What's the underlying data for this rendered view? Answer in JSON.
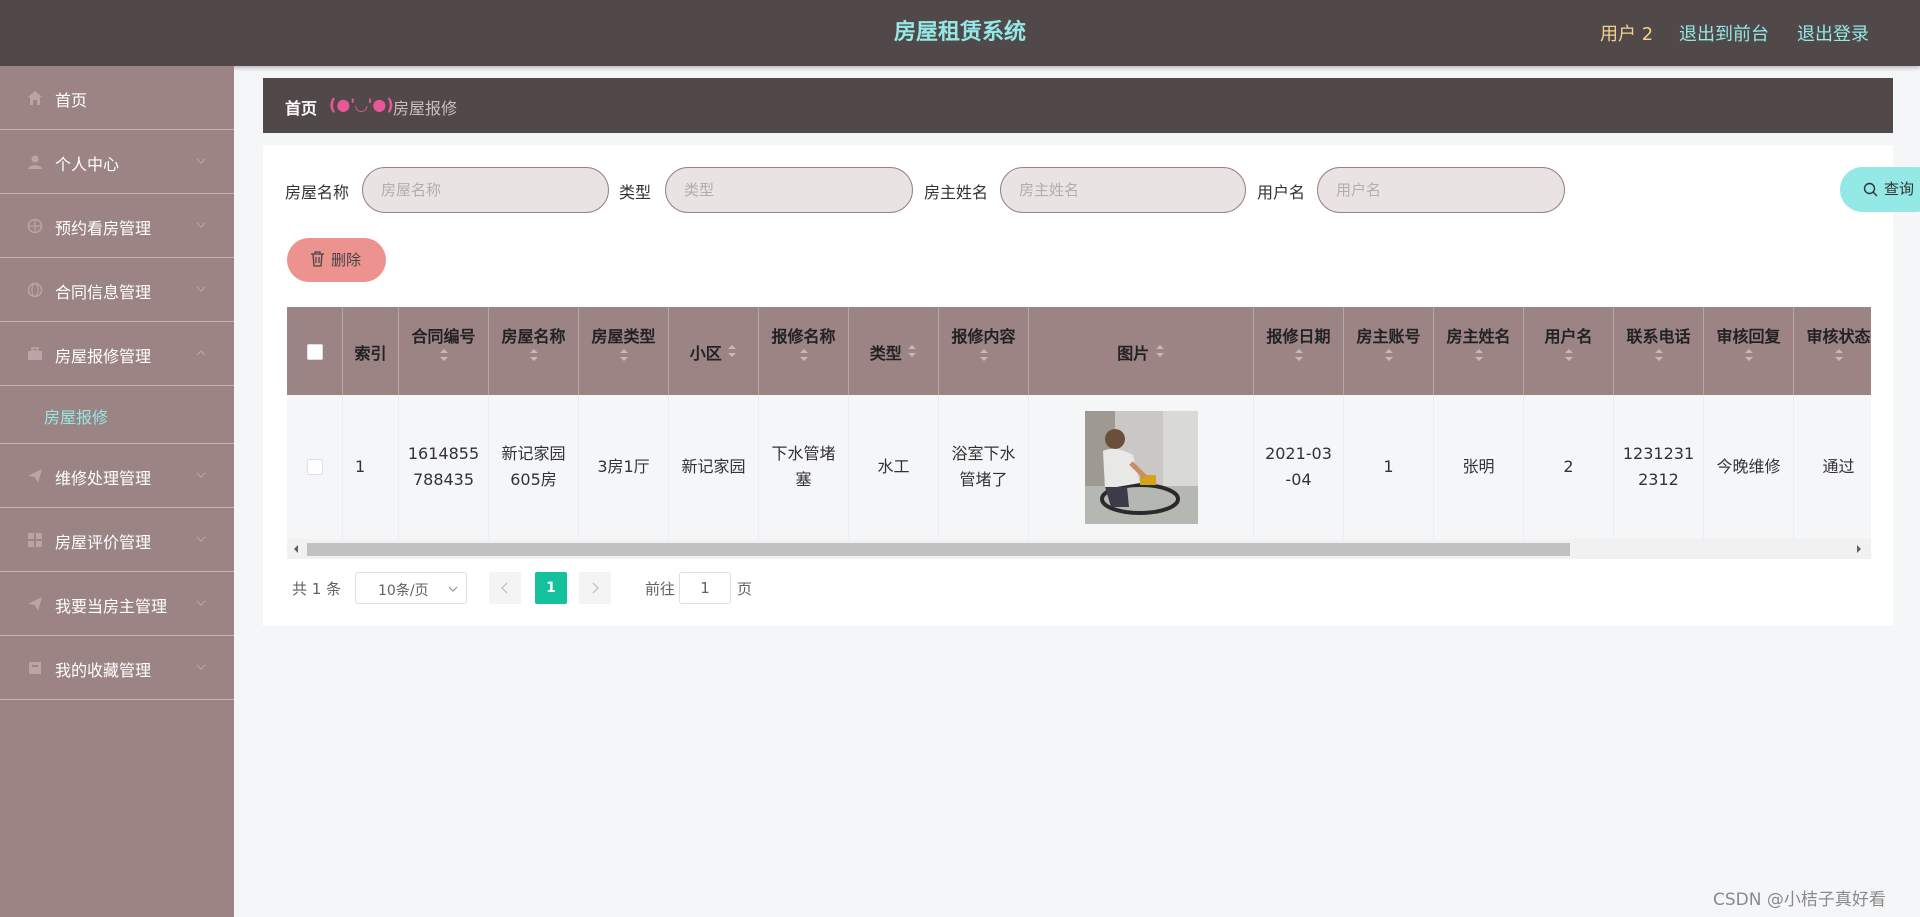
{
  "header": {
    "title": "房屋租赁系统",
    "user": "用户 2",
    "front_link": "退出到前台",
    "logout_link": "退出登录"
  },
  "sidebar": {
    "items": [
      {
        "label": "首页",
        "icon": "home-icon"
      },
      {
        "label": "个人中心",
        "icon": "user-icon"
      },
      {
        "label": "预约看房管理",
        "icon": "basketball-icon"
      },
      {
        "label": "合同信息管理",
        "icon": "globe-icon"
      },
      {
        "label": "房屋报修管理",
        "icon": "briefcase-icon",
        "expanded": true,
        "sub": [
          "房屋报修"
        ]
      },
      {
        "label": "维修处理管理",
        "icon": "send-icon"
      },
      {
        "label": "房屋评价管理",
        "icon": "grid-icon"
      },
      {
        "label": "我要当房主管理",
        "icon": "send-icon"
      },
      {
        "label": "我的收藏管理",
        "icon": "box-icon"
      }
    ]
  },
  "breadcrumb": {
    "home": "首页",
    "separator": "(●'◡'●)",
    "current": "房屋报修"
  },
  "filters": [
    {
      "label": "房屋名称",
      "placeholder": "房屋名称"
    },
    {
      "label": "类型",
      "placeholder": "类型"
    },
    {
      "label": "房主姓名",
      "placeholder": "房主姓名"
    },
    {
      "label": "用户名",
      "placeholder": "用户名"
    }
  ],
  "buttons": {
    "query": "查询",
    "delete": "删除"
  },
  "table": {
    "columns": [
      "",
      "索引",
      "合同编号",
      "房屋名称",
      "房屋类型",
      "小区",
      "报修名称",
      "类型",
      "报修内容",
      "图片",
      "报修日期",
      "房主账号",
      "房主姓名",
      "用户名",
      "联系电话",
      "审核回复",
      "审核状态"
    ],
    "rows": [
      {
        "index": "1",
        "contract_no": "1614855\n788435",
        "house_name": "新记家园\n605房",
        "house_type": "3房1厅",
        "community": "新记家园",
        "repair_name": "下水管堵\n塞",
        "type": "水工",
        "repair_content": "浴室下水\n管堵了",
        "image": "repair-photo",
        "repair_date": "2021-03\n-04",
        "owner_account": "1",
        "owner_name": "张明",
        "username": "2",
        "phone": "1231231\n2312",
        "review_reply": "今晚维修",
        "review_status": "通过"
      }
    ]
  },
  "pagination": {
    "total": "共 1 条",
    "page_size": "10条/页",
    "current_page": "1",
    "goto_label": "前往",
    "goto_value": "1",
    "page_suffix": "页"
  },
  "watermark": "CSDN @小桔子真好看",
  "colors": {
    "header_bg": "#514849",
    "sidebar_bg": "#9c8384",
    "accent_cyan": "#94e8e6",
    "user_gold": "#f0d38b",
    "delete_pink": "#ec9390",
    "page_active": "#13c29c"
  }
}
